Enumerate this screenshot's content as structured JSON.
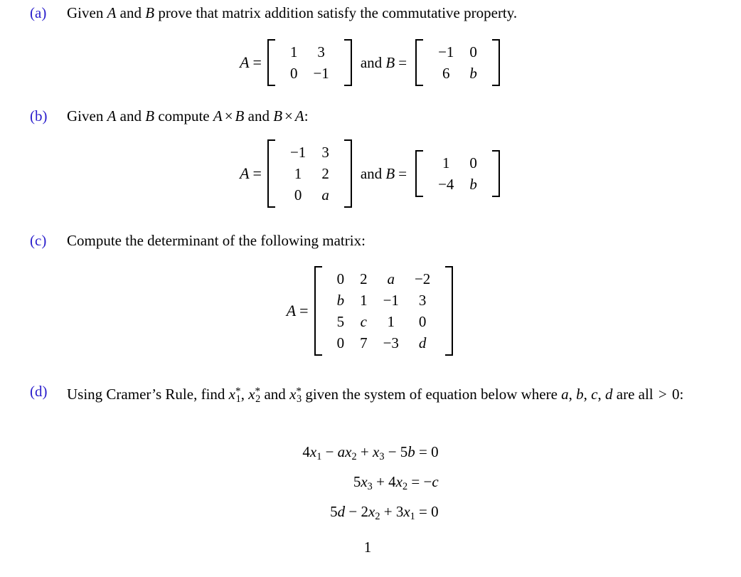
{
  "document": {
    "type": "math-worksheet",
    "page_number": "1",
    "label_color": "#2a1ecc",
    "text_color": "#000000",
    "background": "#ffffff"
  },
  "items": [
    {
      "label": "(a)",
      "text_parts": {
        "p1": "Given ",
        "v1": "A",
        "p2": " and ",
        "v2": "B",
        "p3": " prove that matrix addition satisfy the commutative property."
      },
      "math": {
        "lead_a": "A",
        "lead_eq": "=",
        "conj": "and",
        "lead_b": "B",
        "matrix_a": {
          "rows": 2,
          "cols": 2,
          "cells": [
            [
              "1",
              "3"
            ],
            [
              "0",
              "−1"
            ]
          ],
          "italic_flags": [
            [
              false,
              false
            ],
            [
              false,
              false
            ]
          ]
        },
        "matrix_b": {
          "rows": 2,
          "cols": 2,
          "cells": [
            [
              "−1",
              "0"
            ],
            [
              "6",
              "b"
            ]
          ],
          "italic_flags": [
            [
              false,
              false
            ],
            [
              false,
              true
            ]
          ]
        }
      }
    },
    {
      "label": "(b)",
      "text_parts": {
        "p1": "Given ",
        "v1": "A",
        "p2": " and ",
        "v2": "B",
        "p3": " compute ",
        "v3": "A",
        "times1": "×",
        "v4": "B",
        "p4": " and ",
        "v5": "B",
        "times2": "×",
        "v6": "A",
        "p5": ":"
      },
      "math": {
        "lead_a": "A",
        "lead_eq": "=",
        "conj": "and",
        "lead_b": "B",
        "matrix_a": {
          "rows": 3,
          "cols": 2,
          "cells": [
            [
              "−1",
              "3"
            ],
            [
              "1",
              "2"
            ],
            [
              "0",
              "a"
            ]
          ],
          "italic_flags": [
            [
              false,
              false
            ],
            [
              false,
              false
            ],
            [
              false,
              true
            ]
          ]
        },
        "matrix_b": {
          "rows": 2,
          "cols": 2,
          "cells": [
            [
              "1",
              "0"
            ],
            [
              "−4",
              "b"
            ]
          ],
          "italic_flags": [
            [
              false,
              false
            ],
            [
              false,
              true
            ]
          ]
        }
      }
    },
    {
      "label": "(c)",
      "text_parts": {
        "p1": "Compute the determinant of the following matrix:"
      },
      "math": {
        "lead_a": "A",
        "lead_eq": "=",
        "matrix_a": {
          "rows": 4,
          "cols": 4,
          "cells": [
            [
              "0",
              "2",
              "a",
              "−2"
            ],
            [
              "b",
              "1",
              "−1",
              "3"
            ],
            [
              "5",
              "c",
              "1",
              "0"
            ],
            [
              "0",
              "7",
              "−3",
              "d"
            ]
          ],
          "italic_flags": [
            [
              false,
              false,
              true,
              false
            ],
            [
              true,
              false,
              false,
              false
            ],
            [
              false,
              true,
              false,
              false
            ],
            [
              false,
              false,
              false,
              true
            ]
          ]
        }
      }
    },
    {
      "label": "(d)",
      "text_parts": {
        "p1": "Using Cramer’s Rule, find ",
        "x1": "x",
        "x1sub": "1",
        "x1sup": "*",
        "p2": ", ",
        "x2": "x",
        "x2sub": "2",
        "x2sup": "*",
        "p3": " and ",
        "x3": "x",
        "x3sub": "3",
        "x3sup": "*",
        "p4": " given the system of equation below where ",
        "cond_a": "a",
        "cond_c1": ", ",
        "cond_b": "b",
        "cond_c2": ", ",
        "cond_c": "c",
        "cond_c3": ", ",
        "cond_d": "d",
        "p5": " are all ",
        "gt": ">",
        "p6": " 0:"
      },
      "equations": [
        {
          "parts": [
            {
              "t": "4",
              "k": "n"
            },
            {
              "t": "x",
              "k": "v"
            },
            {
              "t": "1",
              "k": "sub"
            },
            {
              "t": " − ",
              "k": "n"
            },
            {
              "t": "a",
              "k": "v"
            },
            {
              "t": "x",
              "k": "v"
            },
            {
              "t": "2",
              "k": "sub"
            },
            {
              "t": " + ",
              "k": "n"
            },
            {
              "t": "x",
              "k": "v"
            },
            {
              "t": "3",
              "k": "sub"
            },
            {
              "t": " − ",
              "k": "n"
            },
            {
              "t": "5",
              "k": "n"
            },
            {
              "t": "b",
              "k": "v"
            },
            {
              "t": " = ",
              "k": "n"
            },
            {
              "t": "0",
              "k": "n"
            }
          ],
          "plain": "4x₁ − ax₂ + x₃ − 5b = 0"
        },
        {
          "parts": [
            {
              "t": "5",
              "k": "n"
            },
            {
              "t": "x",
              "k": "v"
            },
            {
              "t": "3",
              "k": "sub"
            },
            {
              "t": " + ",
              "k": "n"
            },
            {
              "t": "4",
              "k": "n"
            },
            {
              "t": "x",
              "k": "v"
            },
            {
              "t": "2",
              "k": "sub"
            },
            {
              "t": " = ",
              "k": "n"
            },
            {
              "t": "−",
              "k": "n"
            },
            {
              "t": "c",
              "k": "v"
            }
          ],
          "plain": "5x₃ + 4x₂ = −c"
        },
        {
          "parts": [
            {
              "t": "5",
              "k": "n"
            },
            {
              "t": "d",
              "k": "v"
            },
            {
              "t": " − ",
              "k": "n"
            },
            {
              "t": "2",
              "k": "n"
            },
            {
              "t": "x",
              "k": "v"
            },
            {
              "t": "2",
              "k": "sub"
            },
            {
              "t": " + ",
              "k": "n"
            },
            {
              "t": "3",
              "k": "n"
            },
            {
              "t": "x",
              "k": "v"
            },
            {
              "t": "1",
              "k": "sub"
            },
            {
              "t": " = ",
              "k": "n"
            },
            {
              "t": "0",
              "k": "n"
            }
          ],
          "plain": "5d − 2x₂ + 3x₁ = 0"
        }
      ]
    }
  ]
}
